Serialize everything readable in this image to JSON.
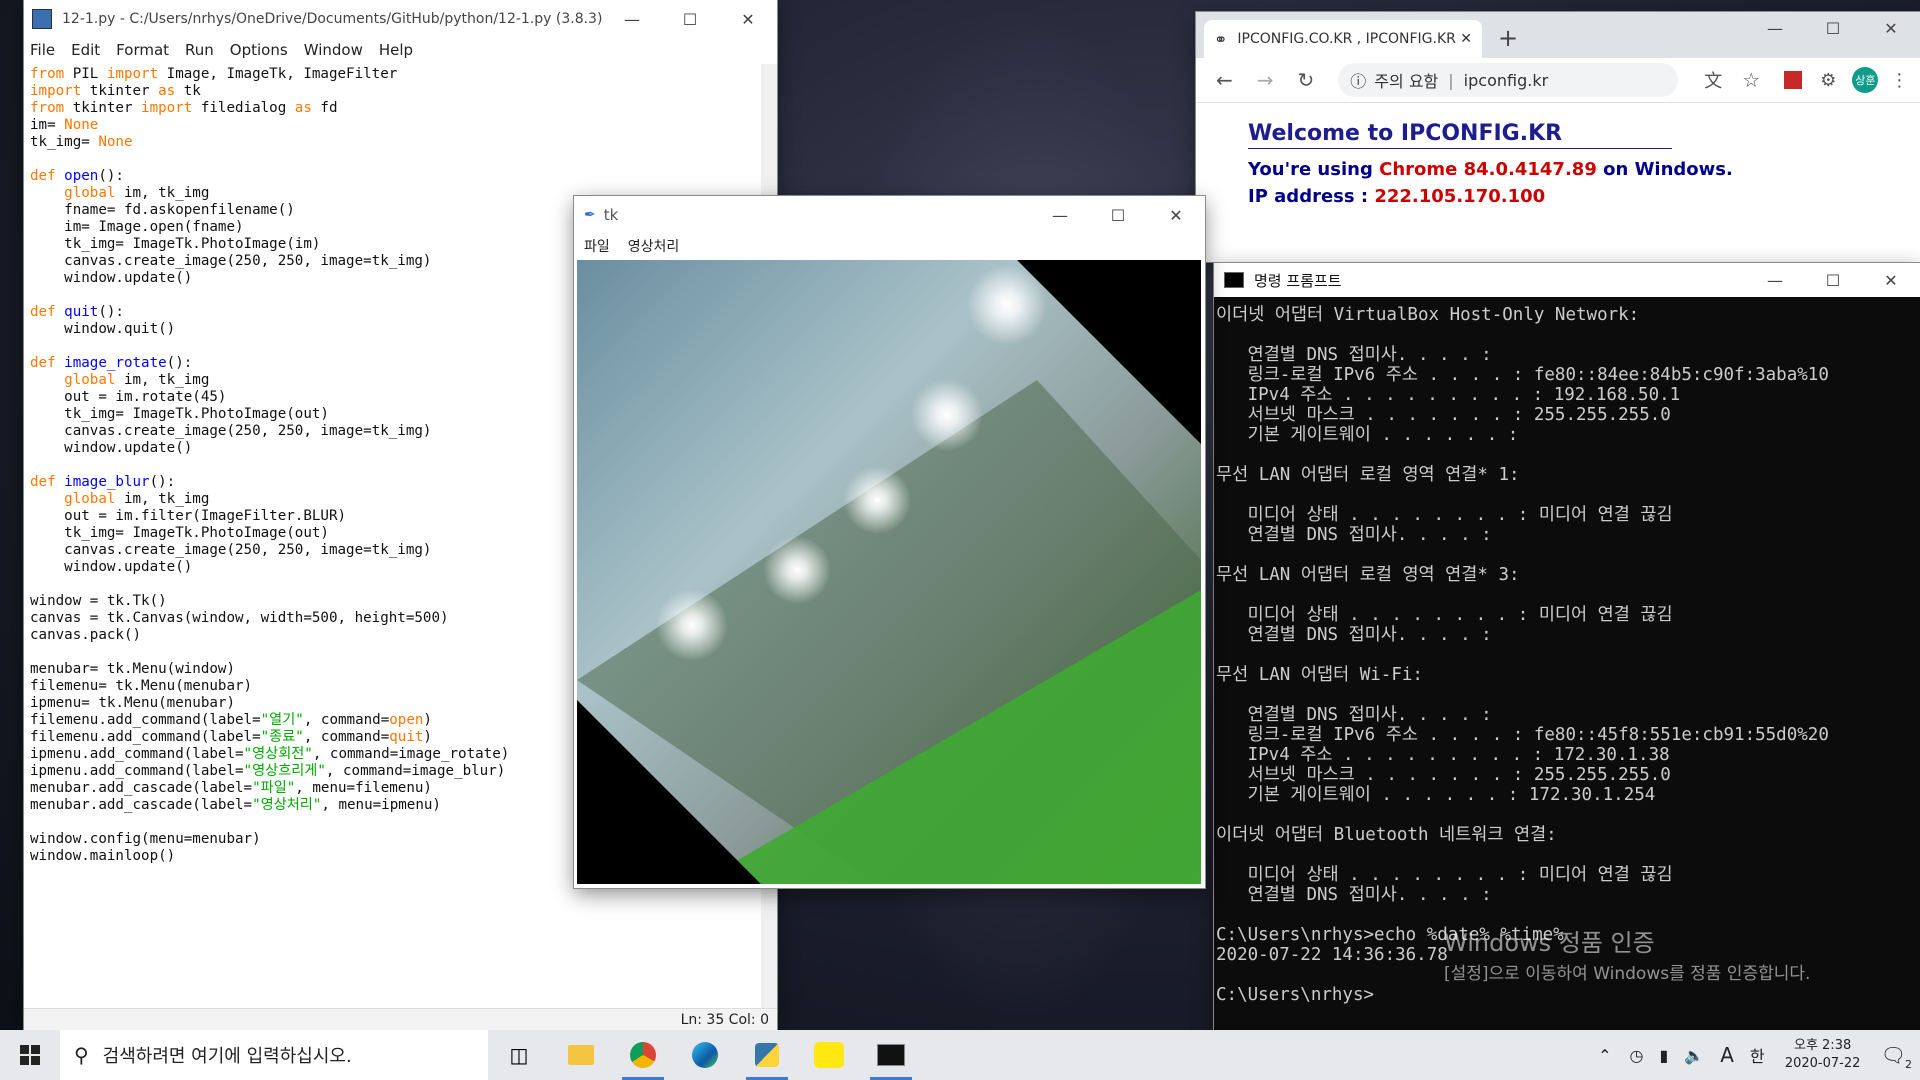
{
  "idle": {
    "title": "12-1.py - C:/Users/nrhys/OneDrive/Documents/GitHub/python/12-1.py (3.8.3)",
    "menu": [
      "File",
      "Edit",
      "Format",
      "Run",
      "Options",
      "Window",
      "Help"
    ],
    "status": "Ln: 35   Col: 0",
    "code_lines": [
      "from PIL import Image, ImageTk, ImageFilter",
      "import tkinter as tk",
      "from tkinter import filedialog as fd",
      "im= None",
      "tk_img= None",
      "",
      "def open():",
      "    global im, tk_img",
      "    fname= fd.askopenfilename()",
      "    im= Image.open(fname)",
      "    tk_img= ImageTk.PhotoImage(im)",
      "    canvas.create_image(250, 250, image=tk_img)",
      "    window.update()",
      "",
      "def quit():",
      "    window.quit()",
      "",
      "def image_rotate():",
      "    global im, tk_img",
      "    out = im.rotate(45)",
      "    tk_img= ImageTk.PhotoImage(out)",
      "    canvas.create_image(250, 250, image=tk_img)",
      "    window.update()",
      "",
      "def image_blur():",
      "    global im, tk_img",
      "    out = im.filter(ImageFilter.BLUR)",
      "    tk_img= ImageTk.PhotoImage(out)",
      "    canvas.create_image(250, 250, image=tk_img)",
      "    window.update()",
      "",
      "window = tk.Tk()",
      "canvas = tk.Canvas(window, width=500, height=500)",
      "canvas.pack()",
      "",
      "menubar= tk.Menu(window)",
      "filemenu= tk.Menu(menubar)",
      "ipmenu= tk.Menu(menubar)",
      "filemenu.add_command(label=\"열기\", command=open)",
      "filemenu.add_command(label=\"종료\", command=quit)",
      "ipmenu.add_command(label=\"영상회전\", command=image_rotate)",
      "ipmenu.add_command(label=\"영상흐리게\", command=image_blur)",
      "menubar.add_cascade(label=\"파일\", menu=filemenu)",
      "menubar.add_cascade(label=\"영상처리\", menu=ipmenu)",
      "",
      "window.config(menu=menubar)",
      "window.mainloop()"
    ]
  },
  "tk": {
    "title": "tk",
    "menu": [
      "파일",
      "영상처리"
    ]
  },
  "chrome": {
    "tab_title": "IPCONFIG.CO.KR , IPCONFIG.KR",
    "security_label": "주의 요함",
    "url": "ipconfig.kr",
    "profile": "상훈",
    "page_title": "Welcome to IPCONFIG.KR",
    "using_prefix": "You're using",
    "browser": "Chrome 84.0.4147.89",
    "using_suffix": "on Windows.",
    "ip_label": "IP address :",
    "ip": "222.105.170.100"
  },
  "cmd": {
    "title": "명령 프롬프트",
    "lines": [
      "이더넷 어댑터 VirtualBox Host-Only Network:",
      "",
      "   연결별 DNS 접미사. . . . :",
      "   링크-로컬 IPv6 주소 . . . . : fe80::84ee:84b5:c90f:3aba%10",
      "   IPv4 주소 . . . . . . . . . : 192.168.50.1",
      "   서브넷 마스크 . . . . . . . : 255.255.255.0",
      "   기본 게이트웨이 . . . . . . :",
      "",
      "무선 LAN 어댑터 로컬 영역 연결* 1:",
      "",
      "   미디어 상태 . . . . . . . . : 미디어 연결 끊김",
      "   연결별 DNS 접미사. . . . :",
      "",
      "무선 LAN 어댑터 로컬 영역 연결* 3:",
      "",
      "   미디어 상태 . . . . . . . . : 미디어 연결 끊김",
      "   연결별 DNS 접미사. . . . :",
      "",
      "무선 LAN 어댑터 Wi-Fi:",
      "",
      "   연결별 DNS 접미사. . . . :",
      "   링크-로컬 IPv6 주소 . . . . : fe80::45f8:551e:cb91:55d0%20",
      "   IPv4 주소 . . . . . . . . . : 172.30.1.38",
      "   서브넷 마스크 . . . . . . . : 255.255.255.0",
      "   기본 게이트웨이 . . . . . . : 172.30.1.254",
      "",
      "이더넷 어댑터 Bluetooth 네트워크 연결:",
      "",
      "   미디어 상태 . . . . . . . . : 미디어 연결 끊김",
      "   연결별 DNS 접미사. . . . :",
      "",
      "C:\\Users\\nrhys>echo %date% %time%",
      "2020-07-22 14:36:36.78",
      "",
      "C:\\Users\\nrhys>"
    ],
    "watermark_title": "Windows 정품 인증",
    "watermark_text": "[설정]으로 이동하여 Windows를 정품 인증합니다."
  },
  "taskbar": {
    "search_placeholder": "검색하려면 여기에 입력하십시오.",
    "ime_a": "A",
    "ime_lang": "한",
    "clock_time": "오후 2:38",
    "clock_date": "2020-07-22",
    "notification_count": "2"
  }
}
